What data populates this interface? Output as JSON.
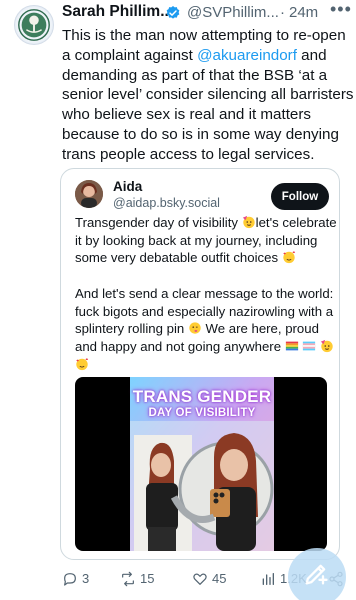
{
  "post": {
    "author_name": "Sarah Phillim...",
    "author_handle": "@SVPhillim...",
    "separator": "·",
    "time": "24m",
    "more_label": "•••",
    "text_before_mention": "This is the man now attempting to re-open a complaint against ",
    "mention": "@akuareindorf",
    "text_after_mention": " and demanding as part of that the BSB ‘at a senior level’ consider silencing all barristers who believe sex is real and it matters because to do so is in some way denying trans people access to legal services."
  },
  "quote": {
    "name": "Aida",
    "handle": "@aidap.bsky.social",
    "follow_label": "Follow",
    "para1_a": "Transgender day of visibility ",
    "para1_b": "let's celebrate it by looking back at my journey, including some very debatable outfit choices",
    "para2_a": "And let's send a clear message to the world: fuck bigots and especially nazirowling with a splintery rolling pin ",
    "para2_b": " We are here, proud and happy and not going anywhere ",
    "media_line1": "TRANS GENDER",
    "media_line2": "DAY OF VISIBILITY"
  },
  "actions": {
    "replies": "3",
    "reposts": "15",
    "likes": "45",
    "views": "1.2K"
  },
  "icons": {
    "avatar": "tree-seal-icon",
    "verified": "verified-badge-icon",
    "reply": "reply-icon",
    "repost": "repost-icon",
    "like": "heart-icon",
    "views": "views-chart-icon",
    "share": "share-icon",
    "compose": "compose-icon"
  },
  "colors": {
    "accent": "#1d9bf0",
    "text": "#0f1419",
    "muted": "#536471",
    "border": "#cfd9de"
  }
}
